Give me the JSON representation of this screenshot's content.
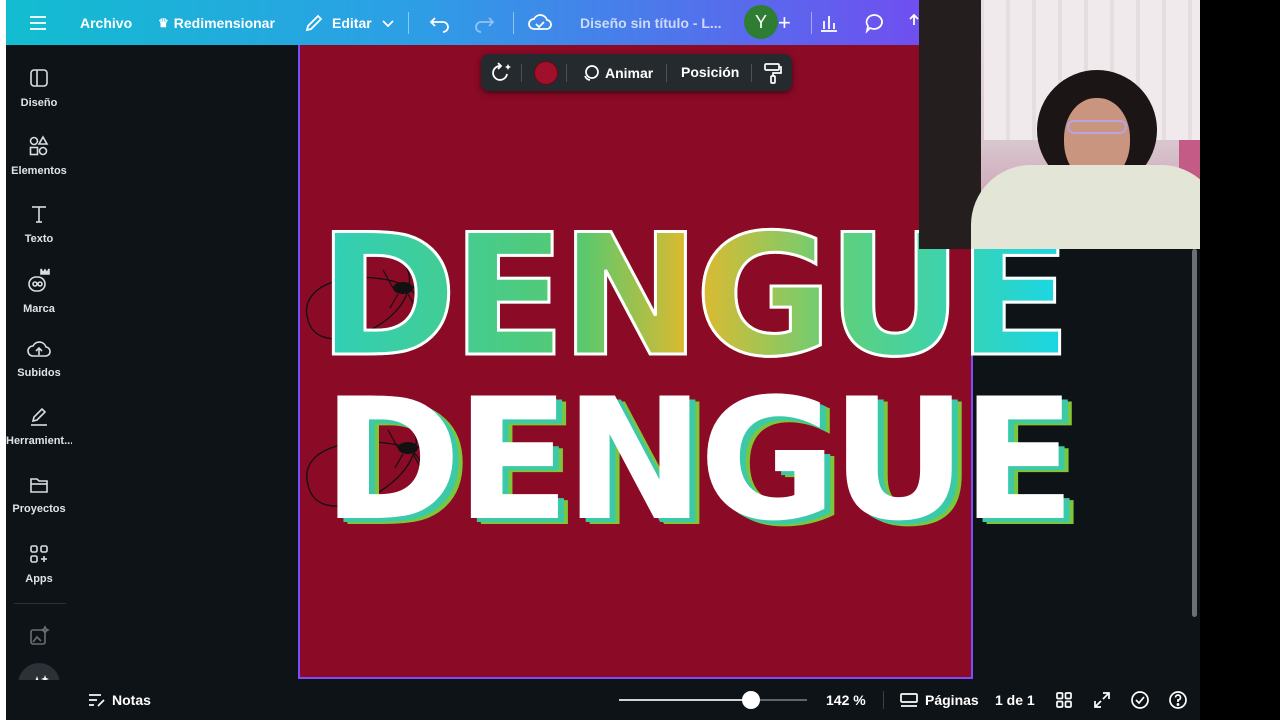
{
  "topbar": {
    "menu_icon": "hamburger-icon",
    "file_label": "Archivo",
    "resize_label": "Redimensionar",
    "edit_label": "Editar",
    "title": "Diseño sin título - L...",
    "avatar_letter": "Y",
    "colors": {
      "gradient_start": "#12bdd0",
      "gradient_end": "#6f4ff0",
      "avatar": "#2f7d32"
    }
  },
  "sidebar": {
    "items": [
      {
        "label": "Diseño",
        "icon": "layout-icon"
      },
      {
        "label": "Elementos",
        "icon": "shapes-icon"
      },
      {
        "label": "Texto",
        "icon": "text-icon"
      },
      {
        "label": "Marca",
        "icon": "brand-icon"
      },
      {
        "label": "Subidos",
        "icon": "upload-cloud-icon"
      },
      {
        "label": "Herramient...",
        "icon": "pen-tool-icon"
      },
      {
        "label": "Proyectos",
        "icon": "folder-icon"
      },
      {
        "label": "Apps",
        "icon": "apps-grid-icon"
      }
    ],
    "magic_icon": "magic-sparkle-icon"
  },
  "floating_toolbar": {
    "animate_label": "Animar",
    "position_label": "Posición",
    "selected_color": "#a0102a"
  },
  "canvas": {
    "background": "#8b0a26",
    "title_line_1": "DENGUE",
    "title_line_2": "DENGUE"
  },
  "bottombar": {
    "notes_label": "Notas",
    "zoom_label": "142 %",
    "zoom_value": 0.7,
    "pages_label": "Páginas",
    "page_count": "1 de 1"
  }
}
